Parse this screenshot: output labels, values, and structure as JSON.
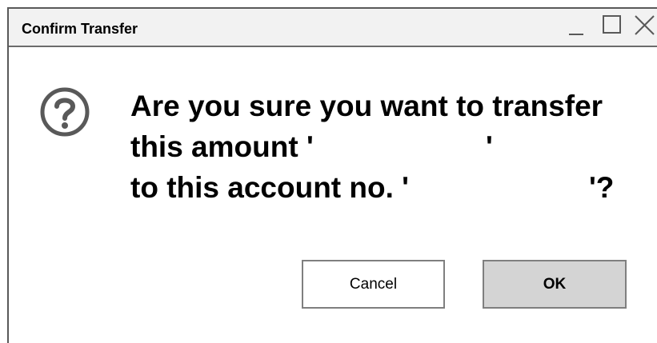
{
  "window": {
    "title": "Confirm Transfer",
    "controls": {
      "minimize_icon": "minimize-icon",
      "maximize_icon": "maximize-icon",
      "close_icon": "close-icon"
    }
  },
  "dialog": {
    "icon": "question-circle-icon",
    "message": {
      "line1": "Are you sure you want to transfer",
      "line2_prefix": "this amount '",
      "line2_suffix": "'",
      "line3_prefix": "to this account no. '",
      "line3_suffix": "'?"
    },
    "amount_value": "",
    "account_value": ""
  },
  "buttons": {
    "cancel_label": "Cancel",
    "ok_label": "OK"
  },
  "colors": {
    "titlebar_bg": "#f2f2f2",
    "ok_button_bg": "#d4d4d4",
    "border": "#7f7f7f",
    "icon": "#595959"
  }
}
